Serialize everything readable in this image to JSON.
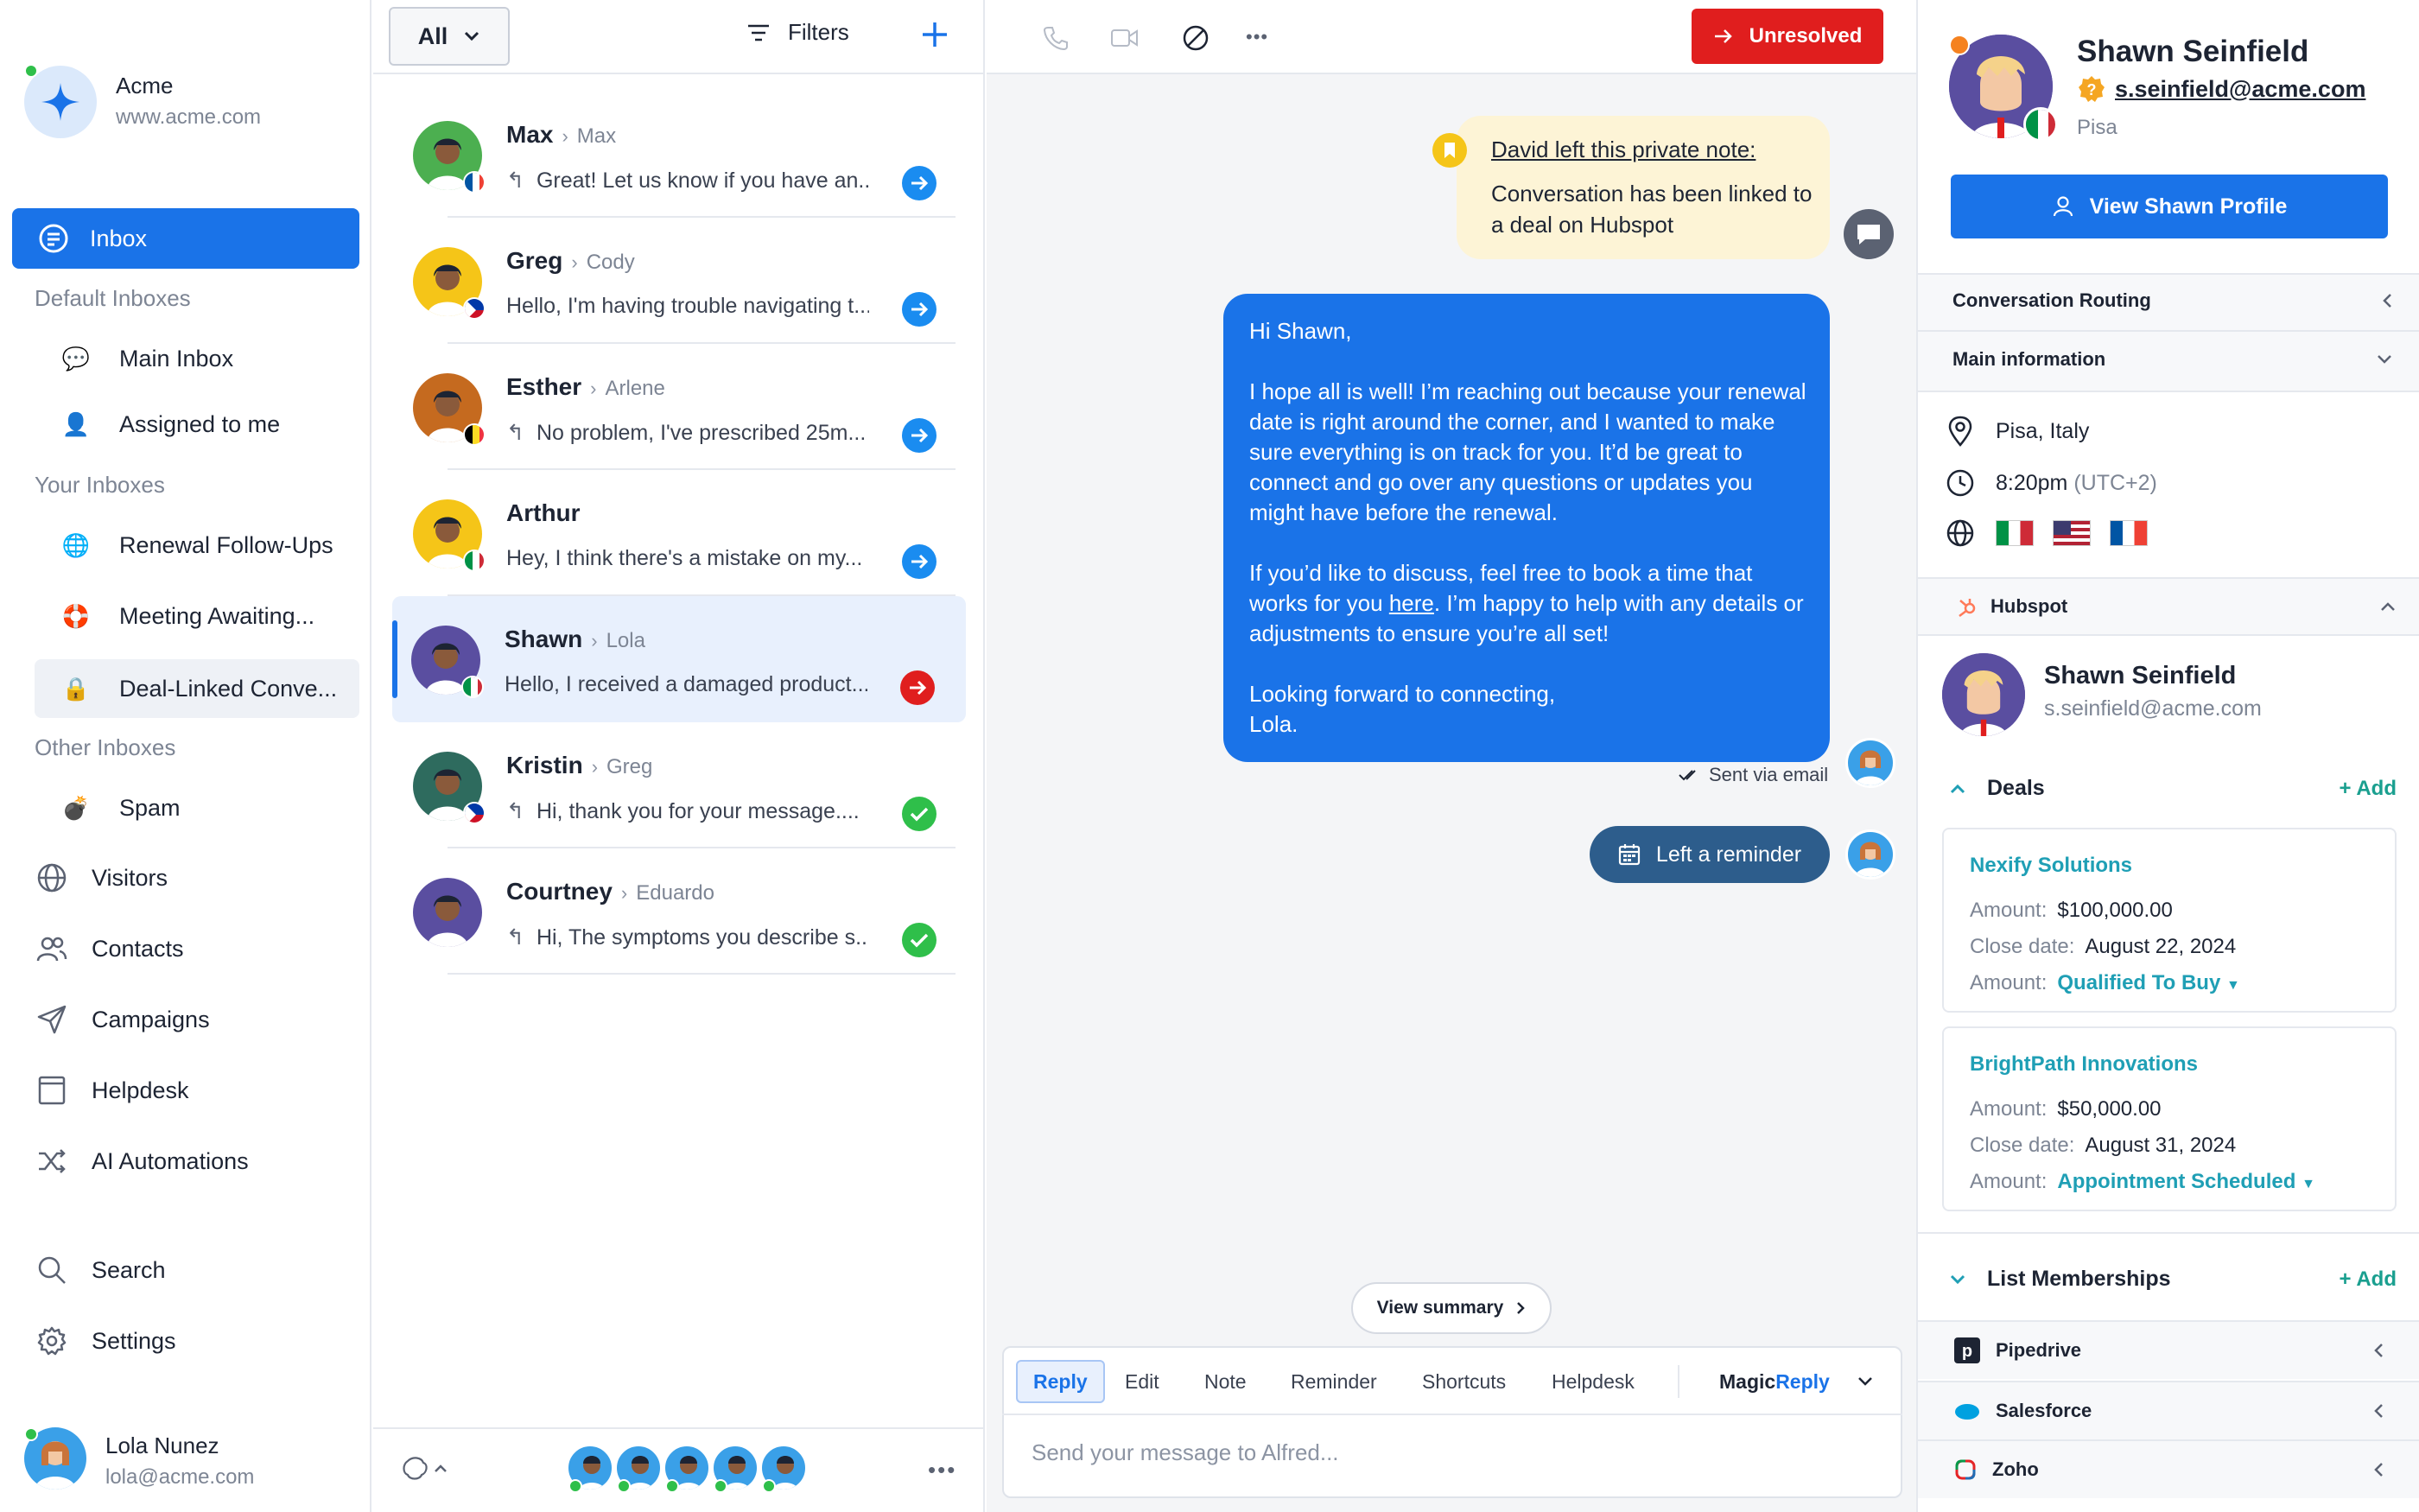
{
  "workspace": {
    "name": "Acme",
    "url": "www.acme.com"
  },
  "sidebar": {
    "inbox_label": "Inbox",
    "default_inboxes_title": "Default Inboxes",
    "default_inboxes": [
      {
        "label": "Main Inbox",
        "icon": "speech-bubble-icon"
      },
      {
        "label": "Assigned to me",
        "icon": "user-icon"
      }
    ],
    "your_inboxes_title": "Your Inboxes",
    "your_inboxes": [
      {
        "label": "Renewal Follow-Ups",
        "icon": "globe-icon"
      },
      {
        "label": "Meeting Awaiting...",
        "icon": "lifebuoy-icon"
      },
      {
        "label": "Deal-Linked Conve...",
        "icon": "lock-icon"
      }
    ],
    "other_inboxes_title": "Other Inboxes",
    "other_inboxes": [
      {
        "label": "Spam",
        "icon": "bomb-icon"
      }
    ],
    "nav": [
      {
        "label": "Visitors",
        "icon": "globe-icon"
      },
      {
        "label": "Contacts",
        "icon": "contacts-icon"
      },
      {
        "label": "Campaigns",
        "icon": "send-icon"
      },
      {
        "label": "Helpdesk",
        "icon": "book-icon"
      },
      {
        "label": "AI Automations",
        "icon": "shuffle-icon"
      }
    ],
    "bottom_nav": [
      {
        "label": "Search",
        "icon": "search-icon"
      },
      {
        "label": "Settings",
        "icon": "gear-icon"
      }
    ],
    "user": {
      "name": "Lola Nunez",
      "email": "lola@acme.com"
    }
  },
  "conversation_list": {
    "filter_value": "All",
    "filters_label": "Filters",
    "items": [
      {
        "name": "Max",
        "assignee": "Max",
        "preview": "Great! Let us know if you have an...",
        "status": "forward",
        "avatar_color": "#4caf50",
        "flag": "fr",
        "reply": true
      },
      {
        "name": "Greg",
        "assignee": "Cody",
        "preview": "Hello, I'm having trouble navigating t...",
        "status": "forward",
        "avatar_color": "#f5c518",
        "flag": "ph",
        "reply": false
      },
      {
        "name": "Esther",
        "assignee": "Arlene",
        "preview": "No problem, I've prescribed 25m...",
        "status": "forward",
        "avatar_color": "#c56a1f",
        "flag": "be",
        "reply": true
      },
      {
        "name": "Arthur",
        "assignee": "",
        "preview": "Hey, I think there's a mistake on my...",
        "status": "forward",
        "avatar_color": "#f5c518",
        "flag": "it",
        "reply": false
      },
      {
        "name": "Shawn",
        "assignee": "Lola",
        "preview": "Hello, I received a damaged product...",
        "status": "urgent",
        "avatar_color": "#5a4ea0",
        "flag": "it",
        "reply": false
      },
      {
        "name": "Kristin",
        "assignee": "Greg",
        "preview": "Hi, thank you for your message....",
        "status": "done",
        "avatar_color": "#2e6b5e",
        "flag": "ph",
        "reply": true
      },
      {
        "name": "Courtney",
        "assignee": "Eduardo",
        "preview": "Hi, The symptoms you describe s...",
        "status": "done",
        "avatar_color": "#5a4ea0",
        "flag": "",
        "reply": true
      }
    ]
  },
  "colors": {
    "accent": "#1a73e8",
    "danger": "#e01e1e",
    "success": "#2fbf4a",
    "teal": "#1f9fb5"
  },
  "main": {
    "status_button": "Unresolved",
    "private_note": {
      "title": "David left this private note:",
      "body": "Conversation has been linked to a deal on Hubspot"
    },
    "email": {
      "greeting": "Hi Shawn,",
      "para1": "I hope all is well! I’m reaching out because your renewal date is right around the corner, and I wanted to make sure everything is on track for you. It’d be great to connect and go over any questions or updates you might have before the renewal.",
      "para2_before": "If you’d like to discuss, feel free to book a time that works for you ",
      "para2_link": "here",
      "para2_after": ". I’m happy to help with any details or adjustments to ensure you’re all set!",
      "closing": "Looking forward to connecting,",
      "signature": "Lola."
    },
    "sent_via": "Sent via email",
    "reminder_label": "Left a reminder",
    "summary_label": "View summary",
    "composer": {
      "tabs": [
        "Reply",
        "Edit",
        "Note",
        "Reminder",
        "Shortcuts",
        "Helpdesk"
      ],
      "magic_prefix": "Magic",
      "magic_suffix": "Reply",
      "placeholder": "Send your message to Alfred..."
    }
  },
  "contact": {
    "name": "Shawn Seinfield",
    "email": "s.seinfield@acme.com",
    "city": "Pisa",
    "view_button": "View Shawn Profile",
    "sections": {
      "routing": "Conversation Routing",
      "main_info": "Main information"
    },
    "location": "Pisa, Italy",
    "time": "8:20pm",
    "timezone": "(UTC+2)",
    "hubspot": {
      "title": "Hubspot",
      "name": "Shawn Seinfield",
      "email": "s.seinfield@acme.com",
      "deals_title": "Deals",
      "add_label": "+ Add",
      "deals": [
        {
          "company": "Nexify Solutions",
          "amount_label": "Amount:",
          "amount": "$100,000.00",
          "close_label": "Close date:",
          "close": "August 22, 2024",
          "stage_label": "Amount:",
          "stage": "Qualified To Buy"
        },
        {
          "company": "BrightPath Innovations",
          "amount_label": "Amount:",
          "amount": "$50,000.00",
          "close_label": "Close date:",
          "close": "August 31, 2024",
          "stage_label": "Amount:",
          "stage": "Appointment Scheduled"
        }
      ],
      "lists_title": "List Memberships"
    },
    "integrations": [
      "Pipedrive",
      "Salesforce",
      "Zoho"
    ]
  }
}
